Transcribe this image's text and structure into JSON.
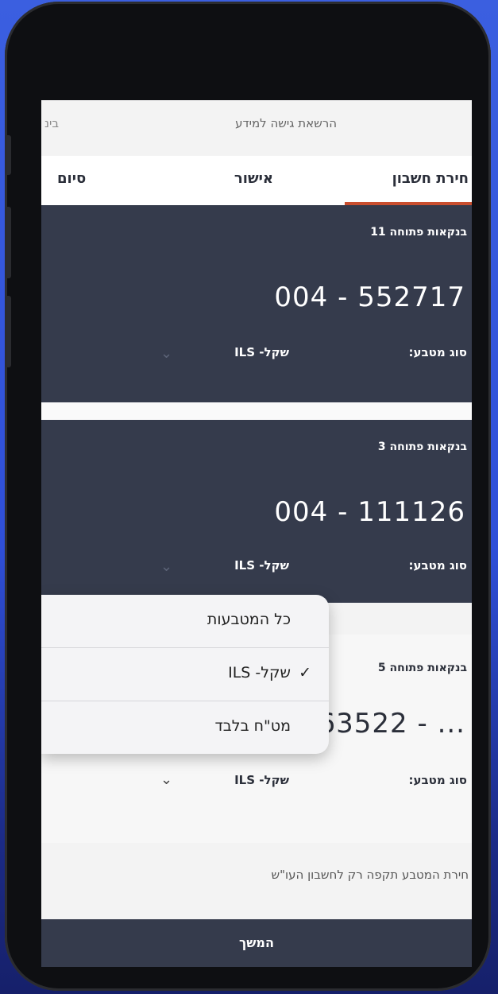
{
  "screen": {
    "header": {
      "title": "הרשאת גישה למידע",
      "back_text": "בינ"
    },
    "tabs": [
      {
        "label": "חירת חשבון",
        "active": true
      },
      {
        "label": "אישור",
        "active": false
      },
      {
        "label": "סיום",
        "active": false
      }
    ],
    "accounts": [
      {
        "label": "בנקאות פתוחה 11",
        "number": "004 - 552717",
        "currency_label": "סוג מטבע:",
        "currency_value": "שקל- ILS"
      },
      {
        "label": "בנקאות פתוחה 3",
        "number": "004 - 111126",
        "currency_label": "סוג מטבע:",
        "currency_value": "שקל- ILS"
      },
      {
        "label": "בנקאות פתוחה 5",
        "number": "663522 - ...",
        "currency_label": "סוג מטבע:",
        "currency_value": "שקל- ILS"
      }
    ],
    "note": "חירת המטבע תקפה רק לחשבון העו\"ש",
    "continue_label": "המשך"
  },
  "dropdown": {
    "options": [
      {
        "label": "כל המטבעות",
        "selected": false
      },
      {
        "label": "שקל- ILS",
        "selected": true
      },
      {
        "label": "מט\"ח בלבד",
        "selected": false
      }
    ],
    "check_glyph": "✓"
  },
  "colors": {
    "card_dark": "#353b4c",
    "accent_tab": "#c94e2e",
    "background": "#3b5fe0"
  }
}
